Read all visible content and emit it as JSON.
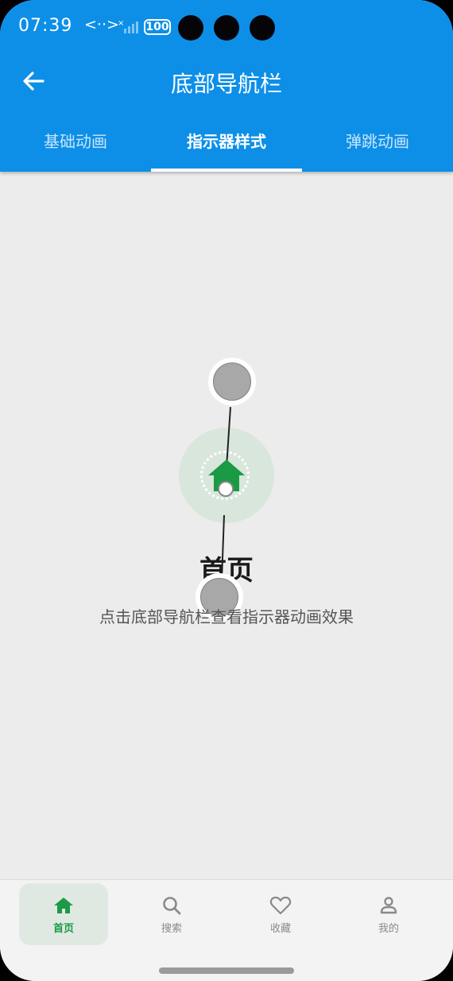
{
  "status_bar": {
    "time": "07:39",
    "network": "<··>",
    "signal": "×",
    "battery": "100"
  },
  "app_bar": {
    "title": "底部导航栏",
    "back_icon": "arrow-left-icon"
  },
  "tabs": [
    {
      "label": "基础动画",
      "active": false
    },
    {
      "label": "指示器样式",
      "active": true
    },
    {
      "label": "弹跳动画",
      "active": false
    }
  ],
  "content": {
    "title": "首页",
    "description": "点击底部导航栏查看指示器动画效果",
    "icon": "home-icon"
  },
  "bottom_nav": [
    {
      "label": "首页",
      "icon": "home-icon",
      "active": true
    },
    {
      "label": "搜索",
      "icon": "search-icon",
      "active": false
    },
    {
      "label": "收藏",
      "icon": "heart-icon",
      "active": false
    },
    {
      "label": "我的",
      "icon": "person-icon",
      "active": false
    }
  ],
  "colors": {
    "primary": "#0d8fe8",
    "accent_green": "#1b9a45",
    "background": "#ececec"
  }
}
